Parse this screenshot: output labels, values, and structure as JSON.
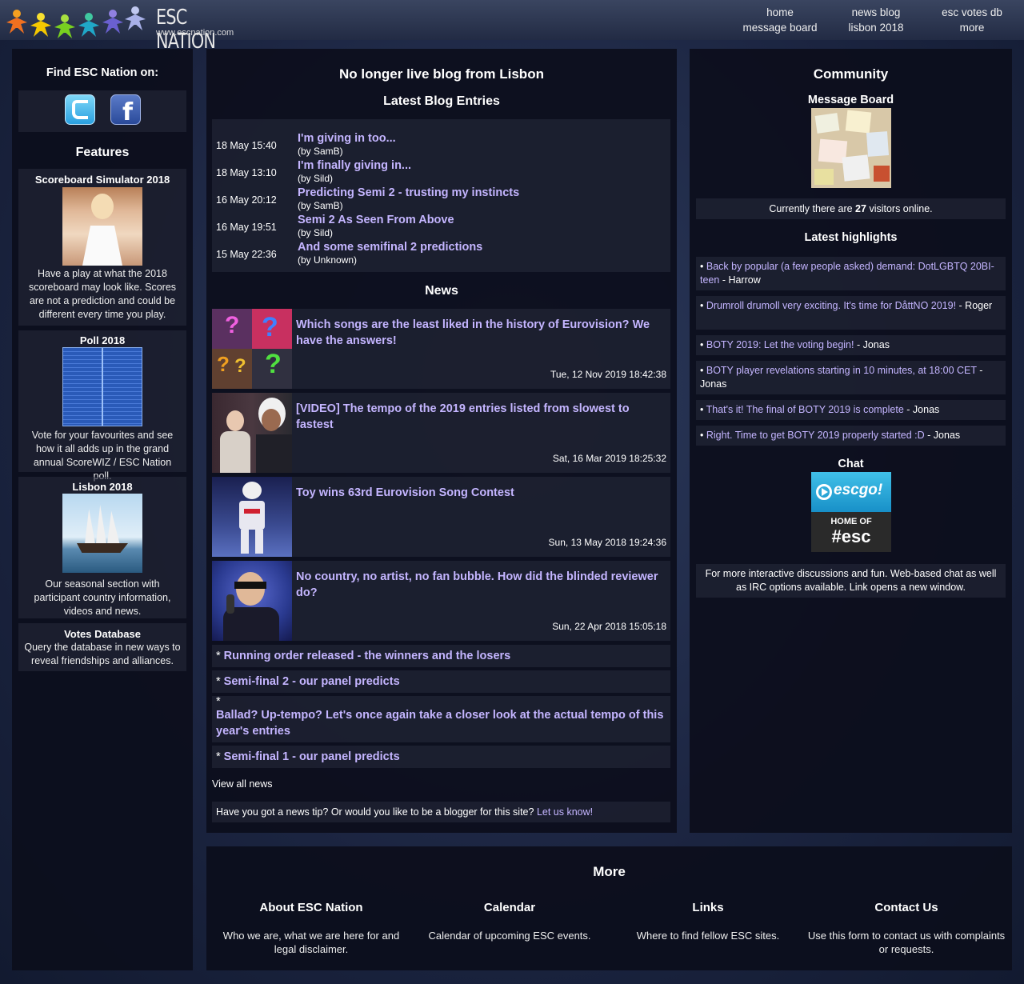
{
  "header": {
    "logo_title": "ESC NATION",
    "logo_url": "www.escnation.com",
    "nav": [
      {
        "top": "home",
        "bottom": "message board"
      },
      {
        "top": "news blog",
        "bottom": "lisbon 2018"
      },
      {
        "top": "esc votes db",
        "bottom": "more"
      }
    ]
  },
  "left": {
    "find_title": "Find ESC Nation on:",
    "features_title": "Features",
    "features": [
      {
        "name": "Scoreboard Simulator 2018",
        "desc": "Have a play at what the 2018 scoreboard may look like. Scores are not a prediction and could be different every time you play."
      },
      {
        "name": "Poll 2018",
        "desc": "Vote for your favourites and see how it all adds up in the grand annual ScoreWIZ / ESC Nation poll."
      },
      {
        "name": "Lisbon 2018",
        "desc": "Our seasonal section with participant country information, videos and news."
      },
      {
        "name": "Votes Database",
        "desc": "Query the database in new ways to reveal friendships and alliances."
      }
    ]
  },
  "center": {
    "title": "No longer live blog from Lisbon",
    "blog_title": "Latest Blog Entries",
    "blog": [
      {
        "date": "18 May 15:40",
        "title": "I'm giving in too...",
        "by": "(by SamB)"
      },
      {
        "date": "18 May 13:10",
        "title": "I'm finally giving in...",
        "by": "(by Sild)"
      },
      {
        "date": "16 May 20:12",
        "title": "Predicting Semi 2 - trusting my instincts",
        "by": "(by SamB)"
      },
      {
        "date": "16 May 19:51",
        "title": "Semi 2 As Seen From Above",
        "by": "(by Sild)"
      },
      {
        "date": "15 May 22:36",
        "title": "And some semifinal 2 predictions",
        "by": "(by Unknown)"
      }
    ],
    "news_title": "News",
    "news": [
      {
        "title": "Which songs are the least liked in the history of Eurovision? We have the answers!",
        "date": "Tue, 12 Nov 2019 18:42:38"
      },
      {
        "title": "[VIDEO] The tempo of the 2019 entries listed from slowest to fastest",
        "date": "Sat, 16 Mar 2019 18:25:32"
      },
      {
        "title": "Toy wins 63rd Eurovision Song Contest",
        "date": "Sun, 13 May 2018 19:24:36"
      },
      {
        "title": "No country, no artist, no fan bubble. How did the blinded reviewer do?",
        "date": "Sun, 22 Apr 2018 15:05:18"
      }
    ],
    "news_links": [
      "Running order released - the winners and the losers",
      "Semi-final 2 - our panel predicts",
      "Ballad? Up-tempo? Let's once again take a closer look at the actual tempo of this year's entries",
      "Semi-final 1 - our panel predicts"
    ],
    "view_all": "View all news",
    "tip_text": "Have you got a news tip? Or would you like to be a blogger for this site?",
    "tip_link": "Let us know!"
  },
  "right": {
    "community_title": "Community",
    "mb_title": "Message Board",
    "visitors_pre": "Currently there are",
    "visitors_count": "27",
    "visitors_post": "visitors online.",
    "highlights_title": "Latest highlights",
    "highlights": [
      {
        "link": "Back by popular (a few people asked) demand: DotLGBTQ 20BI-teen",
        "author": "Harrow"
      },
      {
        "link": "Drumroll drumoll very exciting. It's time for DåttNO 2019!",
        "author": "Roger"
      },
      {
        "link": "BOTY 2019: Let the voting begin!",
        "author": "Jonas"
      },
      {
        "link": "BOTY player revelations starting in 10 minutes, at 18:00 CET",
        "author": "Jonas"
      },
      {
        "link": "That's it! The final of BOTY 2019 is complete",
        "author": "Jonas"
      },
      {
        "link": "Right. Time to get BOTY 2019 properly started :D",
        "author": "Jonas"
      }
    ],
    "chat_title": "Chat",
    "chat_logo": "escgo!",
    "chat_home_of": "HOME OF",
    "chat_channel": "#esc",
    "chat_desc": "For more interactive discussions and fun. Web-based chat as well as IRC options available. Link opens a new window."
  },
  "bottom": {
    "title": "More",
    "cols": [
      {
        "title": "About ESC Nation",
        "desc": "Who we are, what we are here for and legal disclaimer."
      },
      {
        "title": "Calendar",
        "desc": "Calendar of upcoming ESC events."
      },
      {
        "title": "Links",
        "desc": "Where to find fellow ESC sites."
      },
      {
        "title": "Contact Us",
        "desc": "Use this form to contact us with complaints or requests."
      }
    ]
  }
}
